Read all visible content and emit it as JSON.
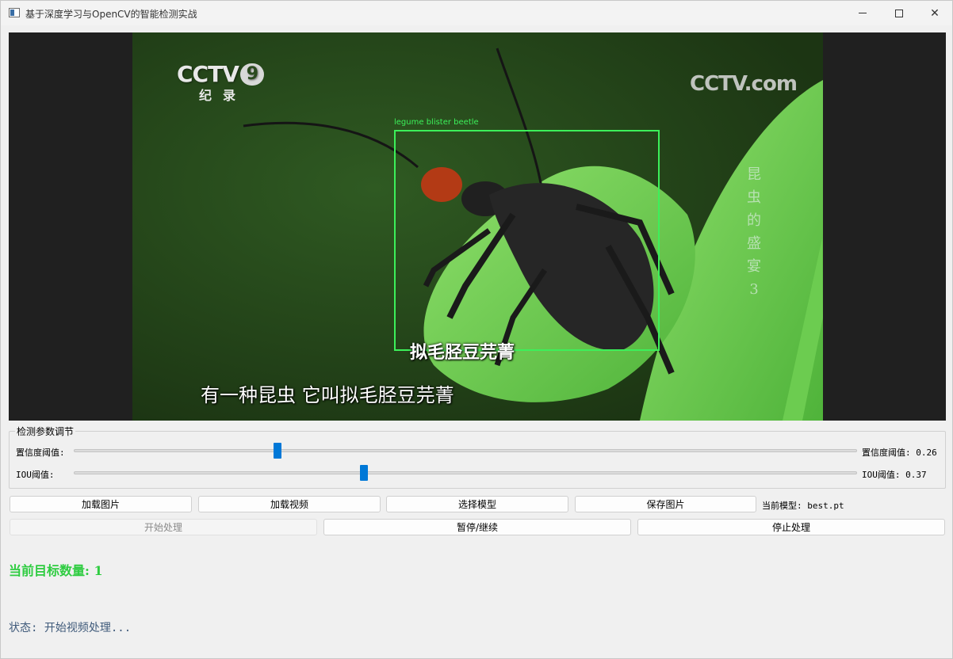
{
  "window": {
    "title": "基于深度学习与OpenCV的智能检测实战"
  },
  "video": {
    "logo_left": "CCTV",
    "logo_left_num": "9",
    "logo_left_sub": "纪录",
    "logo_right": "CCTV.com",
    "side_caption": [
      "昆",
      "虫",
      "的",
      "盛",
      "宴",
      "3"
    ],
    "detection_label": "legume blister beetle",
    "subtitle_name": "拟毛胫豆芫菁",
    "subtitle_bottom": "有一种昆虫 它叫拟毛胫豆芫菁"
  },
  "params": {
    "group_title": "检测参数调节",
    "confidence": {
      "label": "置信度阈值:",
      "value_label": "置信度阈值: 0.26",
      "value": 0.26
    },
    "iou": {
      "label": "IOU阈值:",
      "value_label": "IOU阈值: 0.37",
      "value": 0.37
    }
  },
  "buttons": {
    "load_image": "加载图片",
    "load_video": "加载视频",
    "select_model": "选择模型",
    "save_image": "保存图片",
    "start": "开始处理",
    "pause_resume": "暂停/继续",
    "stop": "停止处理"
  },
  "model": {
    "current_label": "当前模型: best.pt"
  },
  "count": {
    "label": "当前目标数量: 1"
  },
  "status": {
    "label": "状态: 开始视频处理..."
  },
  "colors": {
    "accent": "#0078d7",
    "detection_box": "#3cf05a",
    "count_text": "#2ecc40",
    "status_text": "#3f5a7a"
  }
}
